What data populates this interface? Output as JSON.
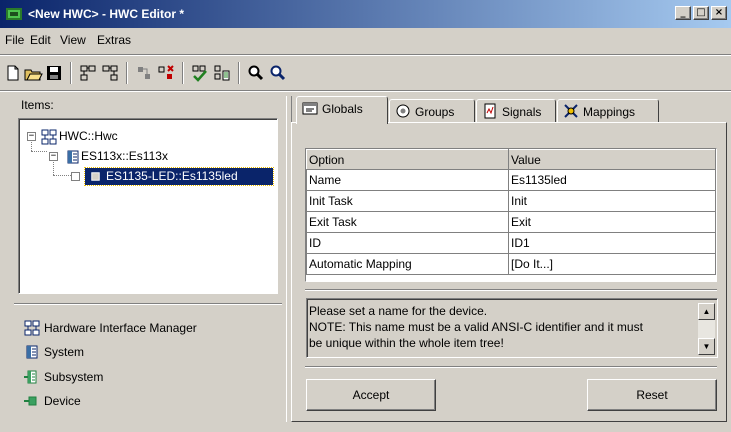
{
  "window": {
    "title": "<New HWC> - HWC Editor  *",
    "minimize": "_",
    "maximize": "□",
    "close": "×"
  },
  "menu": [
    "File",
    "Edit",
    "View",
    "Extras"
  ],
  "toolbar": {
    "icons": [
      "new-icon",
      "open-icon",
      "save-icon",
      "add-system-icon",
      "add-subsystem-icon",
      "add-device-icon",
      "delete-item-icon",
      "check-icon",
      "generate-icon",
      "find-icon",
      "find-next-icon"
    ]
  },
  "items": {
    "label": "Items:",
    "tree": [
      {
        "label": "HWC::Hwc",
        "icon": "hardware-interface-icon",
        "expanded": true
      },
      {
        "label": "ES113x::Es113x",
        "icon": "system-icon",
        "expanded": true
      },
      {
        "label": "ES1135-LED::Es1135led",
        "icon": "device-icon",
        "selected": true
      }
    ]
  },
  "legend": [
    {
      "label": "Hardware Interface Manager",
      "icon": "hardware-interface-icon"
    },
    {
      "label": "System",
      "icon": "system-icon"
    },
    {
      "label": "Subsystem",
      "icon": "subsystem-icon"
    },
    {
      "label": "Device",
      "icon": "device-icon"
    }
  ],
  "tabs": [
    {
      "label": "Globals",
      "icon": "globals-icon",
      "active": true
    },
    {
      "label": "Groups",
      "icon": "groups-icon"
    },
    {
      "label": "Signals",
      "icon": "signals-icon"
    },
    {
      "label": "Mappings",
      "icon": "mappings-icon"
    }
  ],
  "properties": {
    "columns": [
      "Option",
      "Value"
    ],
    "rows": [
      {
        "option": "Name",
        "value": "Es1135led"
      },
      {
        "option": "Init Task",
        "value": "Init"
      },
      {
        "option": "Exit Task",
        "value": "Exit"
      },
      {
        "option": "ID",
        "value": "ID1"
      },
      {
        "option": "Automatic Mapping",
        "value": "[Do It...]"
      }
    ]
  },
  "help": {
    "line1": "Please set a name for the device.",
    "line2": "NOTE: This name must be a valid ANSI-C identifier and it must",
    "line3": "be unique within the whole item tree!"
  },
  "buttons": {
    "accept": "Accept",
    "reset": "Reset"
  },
  "colors": {
    "title_active": "#0a246a",
    "selection": "#0a246a",
    "face": "#d4d0c8"
  }
}
